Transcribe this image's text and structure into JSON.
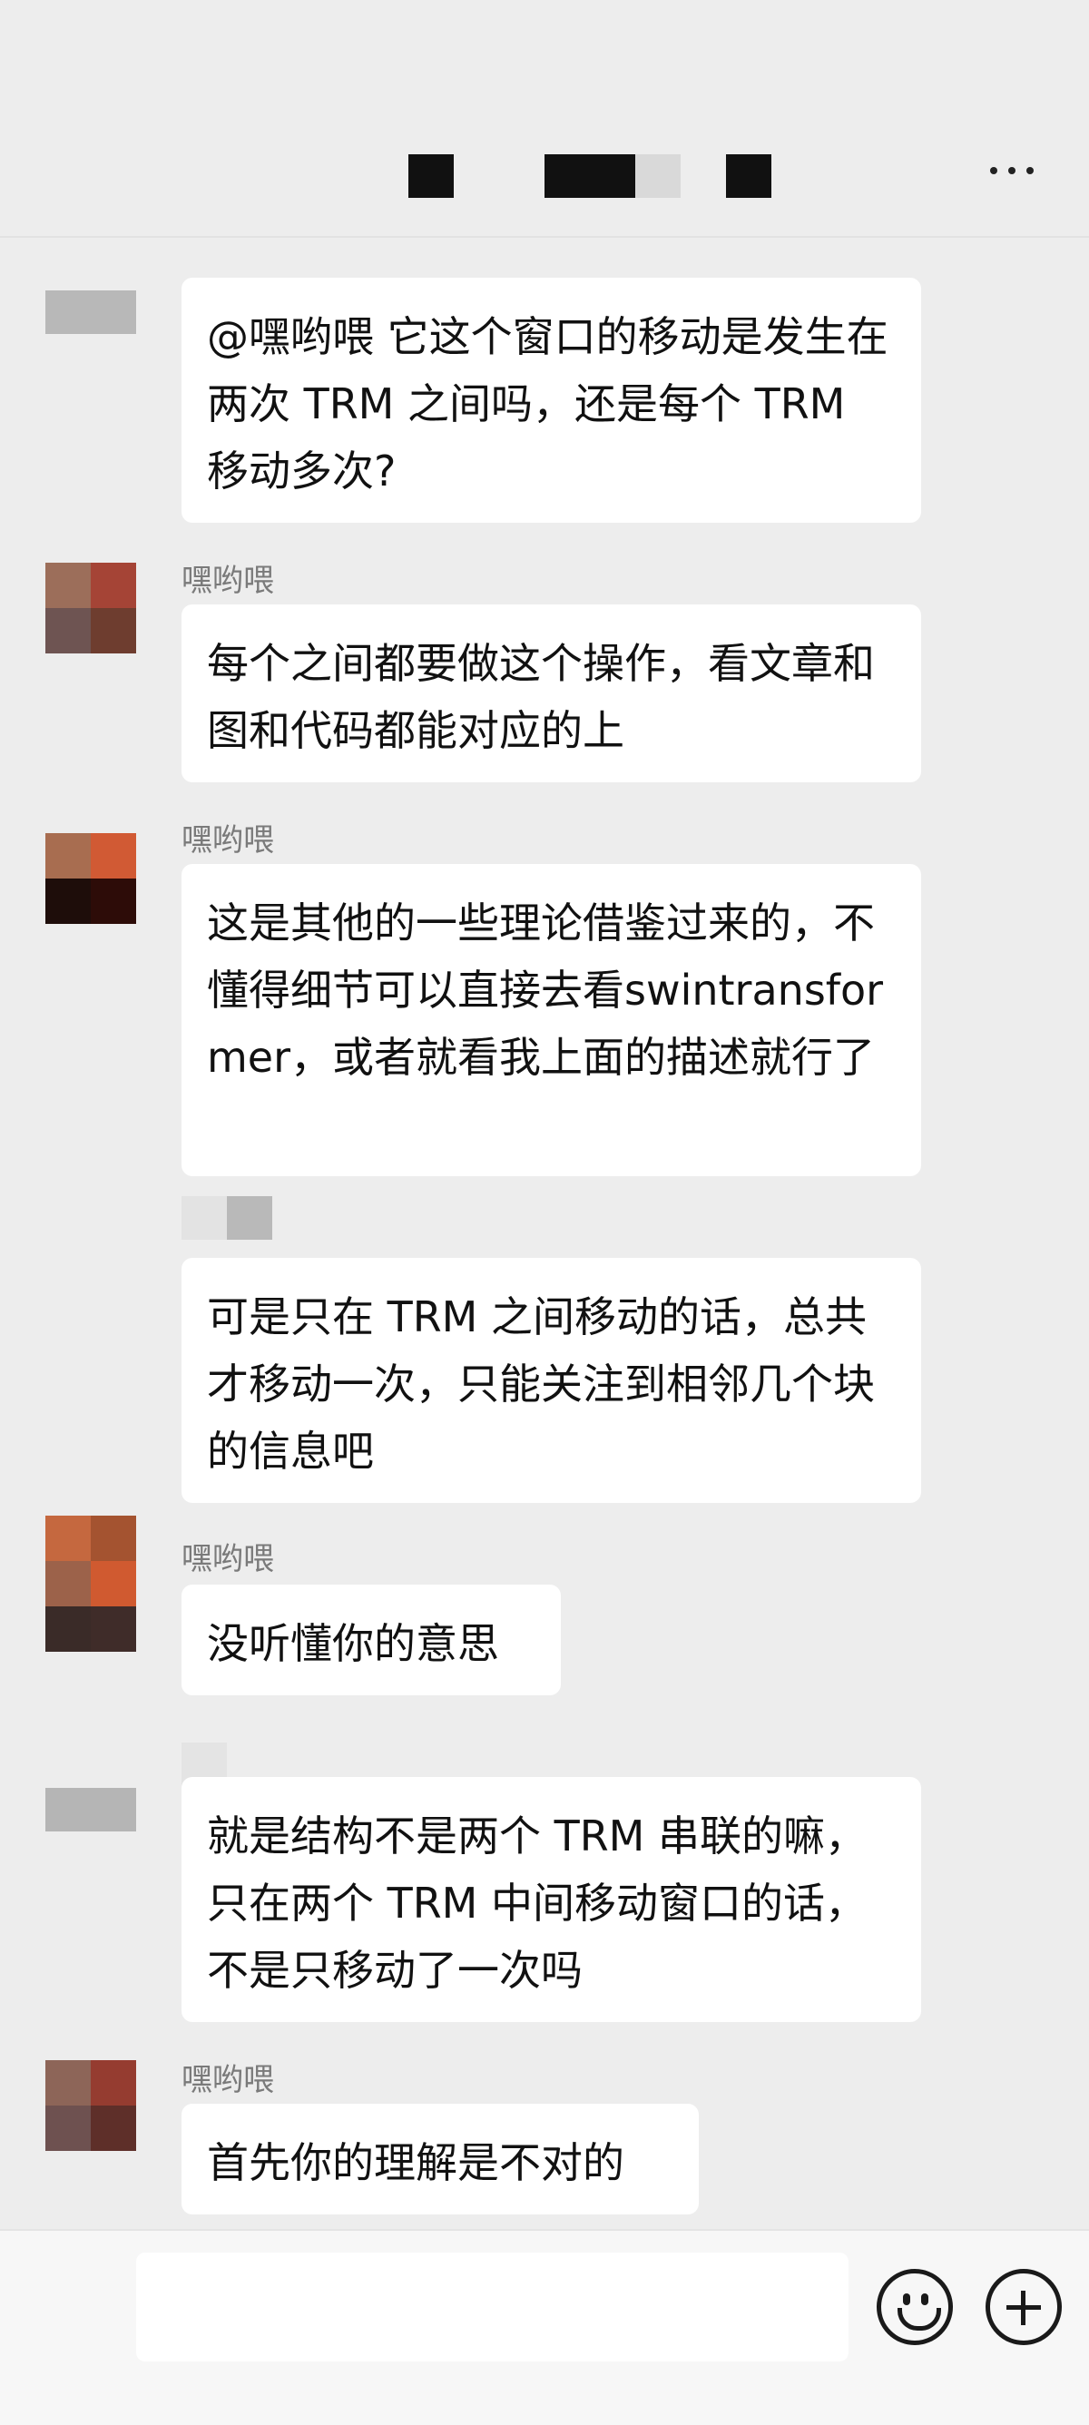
{
  "header": {
    "more_icon": "more-dots-icon"
  },
  "messages": [
    {
      "id": 1,
      "side": "left",
      "sender": "",
      "text": "@嘿哟喂  它这个窗口的移动是发生在两次 TRM 之间吗，还是每个 TRM 移动多次?"
    },
    {
      "id": 2,
      "side": "left",
      "sender": "嘿哟喂",
      "text": "每个之间都要做这个操作，看文章和图和代码都能对应的上"
    },
    {
      "id": 3,
      "side": "left",
      "sender": "嘿哟喂",
      "text": "这是其他的一些理论借鉴过来的，不懂得细节可以直接去看swintransformer，或者就看我上面的描述就行了"
    },
    {
      "id": 4,
      "side": "left",
      "sender": "",
      "text": "可是只在 TRM 之间移动的话，总共才移动一次，只能关注到相邻几个块的信息吧"
    },
    {
      "id": 5,
      "side": "left",
      "sender": "嘿哟喂",
      "text": "没听懂你的意思"
    },
    {
      "id": 6,
      "side": "left",
      "sender": "",
      "text": "就是结构不是两个 TRM 串联的嘛，只在两个 TRM 中间移动窗口的话，不是只移动了一次吗"
    },
    {
      "id": 7,
      "side": "left",
      "sender": "嘿哟喂",
      "text": "首先你的理解是不对的"
    }
  ],
  "input_bar": {
    "emoji_icon": "emoji-smile-icon",
    "plus_icon": "plus-circle-icon"
  }
}
